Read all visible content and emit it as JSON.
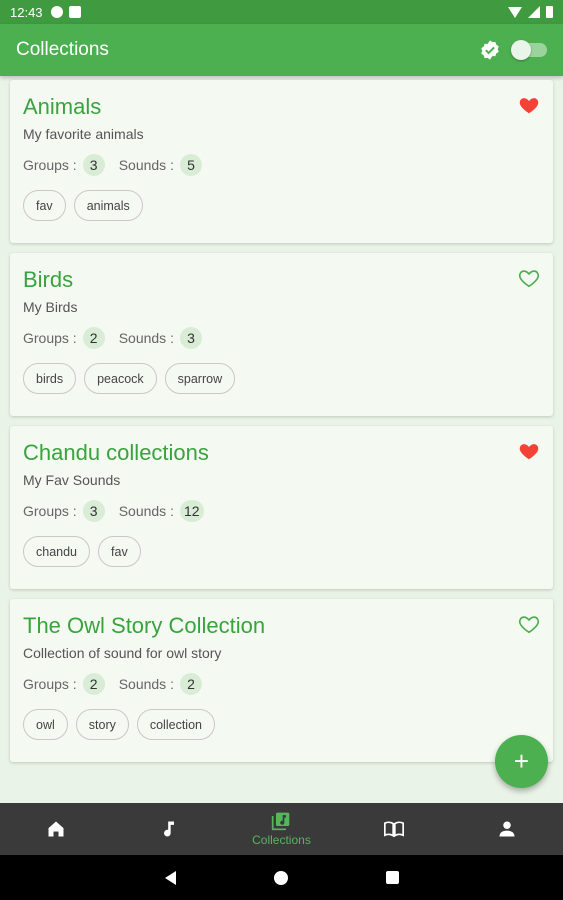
{
  "status": {
    "time": "12:43"
  },
  "app_bar": {
    "title": "Collections"
  },
  "collections": [
    {
      "title": "Animals",
      "description": "My favorite animals",
      "groups_label": "Groups :",
      "groups": "3",
      "sounds_label": "Sounds :",
      "sounds": "5",
      "tags": [
        "fav",
        "animals"
      ],
      "favorite": true
    },
    {
      "title": "Birds",
      "description": "My Birds",
      "groups_label": "Groups :",
      "groups": "2",
      "sounds_label": "Sounds :",
      "sounds": "3",
      "tags": [
        "birds",
        "peacock",
        "sparrow"
      ],
      "favorite": false
    },
    {
      "title": "Chandu collections",
      "description": "My Fav Sounds",
      "groups_label": "Groups :",
      "groups": "3",
      "sounds_label": "Sounds :",
      "sounds": "12",
      "tags": [
        "chandu",
        "fav"
      ],
      "favorite": true
    },
    {
      "title": "The Owl Story Collection",
      "description": "Collection of sound for owl story",
      "groups_label": "Groups :",
      "groups": "2",
      "sounds_label": "Sounds :",
      "sounds": "2",
      "tags": [
        "owl",
        "story",
        "collection"
      ],
      "favorite": false
    }
  ],
  "fab": {
    "icon": "plus-icon",
    "glyph": "+"
  },
  "bottom_nav": {
    "items": [
      {
        "icon": "home-icon",
        "label": ""
      },
      {
        "icon": "music-note-icon",
        "label": ""
      },
      {
        "icon": "collections-icon",
        "label": "Collections",
        "active": true
      },
      {
        "icon": "book-icon",
        "label": ""
      },
      {
        "icon": "person-icon",
        "label": ""
      }
    ]
  },
  "colors": {
    "primary": "#4caf50",
    "favorite": "#f44336",
    "title_green": "#3aa33d"
  }
}
